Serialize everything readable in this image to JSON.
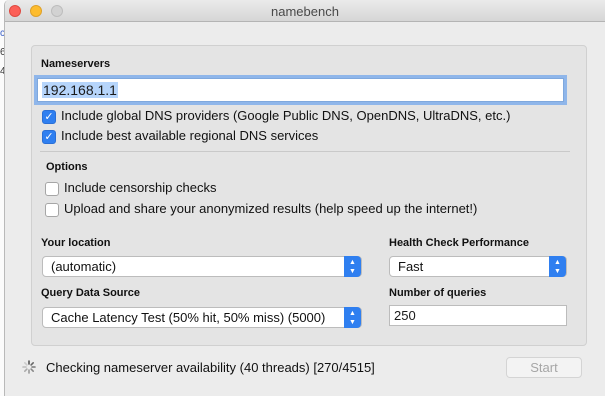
{
  "window": {
    "title": "namebench"
  },
  "nameservers": {
    "heading": "Nameservers",
    "value": "192.168.1.1",
    "include_global_label": "Include global DNS providers (Google Public DNS, OpenDNS, UltraDNS, etc.)",
    "include_global_checked": true,
    "include_regional_label": "Include best available regional DNS services",
    "include_regional_checked": true
  },
  "options": {
    "heading": "Options",
    "censorship_label": "Include censorship checks",
    "censorship_checked": false,
    "upload_label": "Upload and share your anonymized results (help speed up the internet!)",
    "upload_checked": false
  },
  "location": {
    "label": "Your location",
    "value": "(automatic)"
  },
  "health_check": {
    "label": "Health Check Performance",
    "value": "Fast"
  },
  "query_source": {
    "label": "Query Data Source",
    "value": "Cache Latency Test (50% hit, 50% miss) (5000)"
  },
  "num_queries": {
    "label": "Number of queries",
    "value": "250"
  },
  "status": {
    "text": "Checking nameserver availability (40 threads) [270/4515]"
  },
  "start_button": {
    "label": "Start",
    "enabled": false
  },
  "background_window": {
    "glyphs": [
      "c",
      "6",
      "4"
    ]
  },
  "colors": {
    "accent": "#2f7ff0",
    "close": "#fc5f57",
    "minimize": "#fdbc2e"
  }
}
